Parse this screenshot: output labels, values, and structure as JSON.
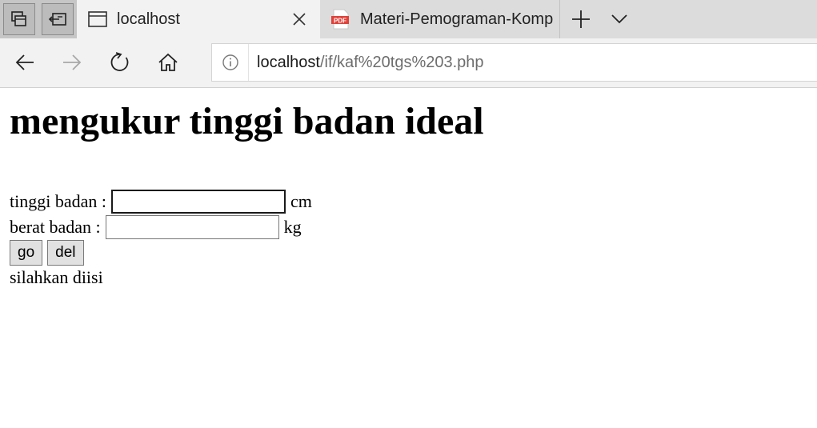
{
  "browser": {
    "tab_strip": {
      "active_tab": {
        "title": "localhost",
        "favicon": "page-icon",
        "close": "close-icon"
      },
      "inactive_tab": {
        "title": "Materi-Pemograman-Komp",
        "favicon": "pdf-icon",
        "favicon_label": "PDF"
      },
      "buttons": [
        "tab-preview-icon",
        "set-aside-tabs-icon",
        "new-tab-icon",
        "tab-list-chevron-icon"
      ]
    },
    "navigation": {
      "buttons": [
        "back-arrow-icon",
        "forward-arrow-icon",
        "refresh-icon",
        "home-icon"
      ],
      "address": {
        "host": "localhost",
        "path": "/if/kaf%20tgs%203.php",
        "info_icon": "info-icon"
      }
    }
  },
  "page": {
    "heading": "mengukur tinggi badan ideal",
    "form": {
      "height_label": "tinggi badan :",
      "height_value": "",
      "height_unit": "cm",
      "weight_label": "berat badan :",
      "weight_value": "",
      "weight_unit": "kg",
      "go_button": "go",
      "delete_button": "del"
    },
    "message": "silahkan diisi"
  },
  "colors": {
    "tab_strip_bg": "#dcdcdc",
    "active_tab_bg": "#f2f2f2",
    "pdf_red": "#e0423a"
  }
}
